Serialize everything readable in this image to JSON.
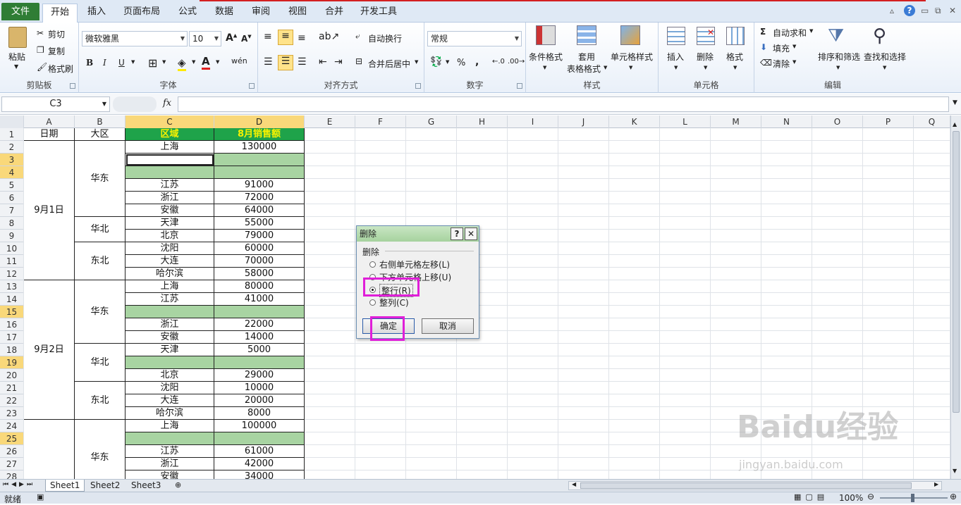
{
  "tabs": {
    "file": "文件",
    "items": [
      "开始",
      "插入",
      "页面布局",
      "公式",
      "数据",
      "审阅",
      "视图",
      "合并",
      "开发工具"
    ]
  },
  "ribbon": {
    "clipboard": {
      "paste": "粘贴",
      "cut": "剪切",
      "copy": "复制",
      "format_painter": "格式刷",
      "label": "剪贴板"
    },
    "font": {
      "name": "微软雅黑",
      "size": "10",
      "bold": "B",
      "italic": "I",
      "underline": "U",
      "label": "字体"
    },
    "alignment": {
      "wrap": "自动换行",
      "merge": "合并后居中",
      "label": "对齐方式"
    },
    "number": {
      "format": "常规",
      "percent": "%",
      "comma": ",",
      "label": "数字"
    },
    "styles": {
      "conditional": "条件格式",
      "table_format_1": "套用",
      "table_format_2": "表格格式",
      "cell_styles": "单元格样式",
      "label": "样式"
    },
    "cells": {
      "insert": "插入",
      "delete": "删除",
      "format": "格式",
      "label": "单元格"
    },
    "editing": {
      "autosum": "自动求和",
      "fill": "填充",
      "clear": "清除",
      "sort": "排序和筛选",
      "find": "查找和选择",
      "label": "编辑"
    }
  },
  "formula_bar": {
    "name_box": "C3",
    "fx": "fx",
    "value": ""
  },
  "columns": [
    "A",
    "B",
    "C",
    "D",
    "E",
    "F",
    "G",
    "H",
    "I",
    "J",
    "K",
    "L",
    "M",
    "N",
    "O",
    "P",
    "Q"
  ],
  "rows": [
    "1",
    "2",
    "3",
    "4",
    "5",
    "6",
    "7",
    "8",
    "9",
    "10",
    "11",
    "12",
    "13",
    "14",
    "15",
    "16",
    "17",
    "18",
    "19",
    "20",
    "21",
    "22",
    "23",
    "24",
    "25",
    "26",
    "27",
    "28"
  ],
  "table": {
    "headers": {
      "date": "日期",
      "region_big": "大区",
      "region": "区域",
      "sales": "8月销售额"
    },
    "dates": [
      "9月1日",
      "9月2日"
    ],
    "big_regions": [
      "华东",
      "华北",
      "东北",
      "华东",
      "华北",
      "东北",
      "华东"
    ],
    "cells": [
      {
        "c": "上海",
        "d": "130000"
      },
      {
        "c": "",
        "d": ""
      },
      {
        "c": "",
        "d": ""
      },
      {
        "c": "江苏",
        "d": "91000"
      },
      {
        "c": "浙江",
        "d": "72000"
      },
      {
        "c": "安徽",
        "d": "64000"
      },
      {
        "c": "天津",
        "d": "55000"
      },
      {
        "c": "北京",
        "d": "79000"
      },
      {
        "c": "沈阳",
        "d": "60000"
      },
      {
        "c": "大连",
        "d": "70000"
      },
      {
        "c": "哈尔滨",
        "d": "58000"
      },
      {
        "c": "上海",
        "d": "80000"
      },
      {
        "c": "江苏",
        "d": "41000"
      },
      {
        "c": "",
        "d": ""
      },
      {
        "c": "浙江",
        "d": "22000"
      },
      {
        "c": "安徽",
        "d": "14000"
      },
      {
        "c": "天津",
        "d": "5000"
      },
      {
        "c": "",
        "d": ""
      },
      {
        "c": "北京",
        "d": "29000"
      },
      {
        "c": "沈阳",
        "d": "10000"
      },
      {
        "c": "大连",
        "d": "20000"
      },
      {
        "c": "哈尔滨",
        "d": "8000"
      },
      {
        "c": "上海",
        "d": "100000"
      },
      {
        "c": "",
        "d": ""
      },
      {
        "c": "江苏",
        "d": "61000"
      },
      {
        "c": "浙江",
        "d": "42000"
      },
      {
        "c": "安徽",
        "d": "34000"
      }
    ]
  },
  "dialog": {
    "title": "删除",
    "help": "?",
    "close": "✕",
    "section": "删除",
    "options": [
      "右侧单元格左移(L)",
      "下方单元格上移(U)",
      "整行(R)",
      "整列(C)"
    ],
    "selected": "整行(R)",
    "ok": "确定",
    "cancel": "取消"
  },
  "sheets": [
    "Sheet1",
    "Sheet2",
    "Sheet3"
  ],
  "status": {
    "ready": "就绪",
    "zoom": "100%"
  },
  "watermark": {
    "main": "Baidu经验",
    "sub": "jingyan.baidu.com"
  },
  "colors": {
    "header_green": "#1fa34a",
    "header_text": "#f8f200",
    "blank_row": "#a8d4a2",
    "highlight": "#e01fd8",
    "file_tab": "#2f7d35"
  }
}
